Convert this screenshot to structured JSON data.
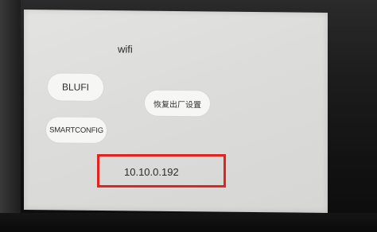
{
  "screen": {
    "title": "wifi",
    "buttons": {
      "blufi": "BLUFI",
      "smartconfig": "SMARTCONFIG",
      "reset": "恢复出厂设置"
    },
    "ip_address": "10.10.0.192"
  },
  "colors": {
    "screen_bg": "#dcdcda",
    "button_bg": "#f6f6f5",
    "highlight_border": "#e4231e"
  }
}
